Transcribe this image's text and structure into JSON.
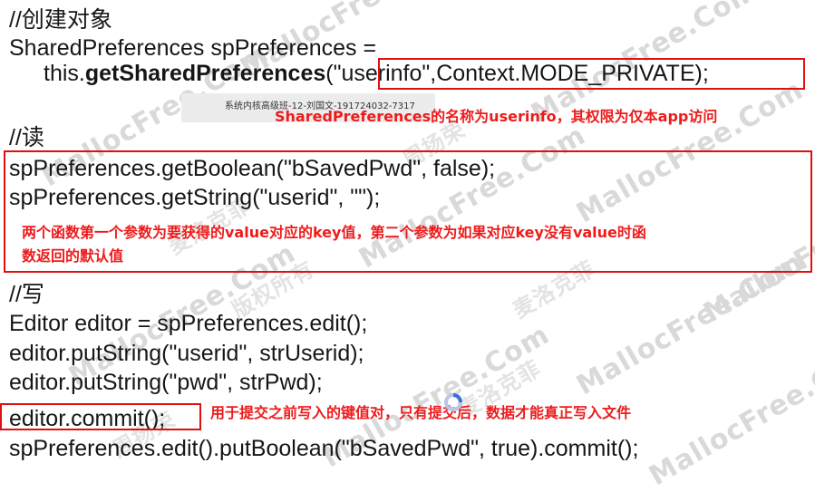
{
  "watermark": {
    "site": "MallocFree.Com",
    "cn": "麦洛克菲",
    "cn2": "周扬荣",
    "cn3": "版权所有"
  },
  "lines": {
    "c1": "//创建对象",
    "c2": "SharedPreferences spPreferences =",
    "c3_pre": "this.",
    "c3_method": "getSharedPreferences",
    "c3_paren": "(",
    "c3_args": "\"userinfo\",Context.MODE_PRIVATE);",
    "c4": "//读",
    "c5": "spPreferences.getBoolean(\"bSavedPwd\", false);",
    "c6": "spPreferences.getString(\"userid\", \"\");",
    "c7": "//写",
    "c8": "Editor editor = spPreferences.edit();",
    "c9": "editor.putString(\"userid\", strUserid);",
    "c10": "editor.putString(\"pwd\", strPwd);",
    "c11": "editor.commit();",
    "c12": "spPreferences.edit().putBoolean(\"bSavedPwd\", true).commit();"
  },
  "band_text": "系统内核高级班-12-刘国文-191724032-7317",
  "notes": {
    "n1": "SharedPreferences的名称为userinfo，其权限为仅本app访问",
    "n2a": "两个函数第一个参数为要获得的value对应的key值，第二个参数为如果对应key没有value时函",
    "n2b": "数返回的默认值",
    "n3": "用于提交之前写入的键值对，只有提交后，数据才能真正写入文件"
  },
  "colors": {
    "annotation": "#ee1b1b",
    "box": "#e01010",
    "code": "#161616"
  },
  "icons": {
    "cursor": "busy-cursor-icon"
  }
}
